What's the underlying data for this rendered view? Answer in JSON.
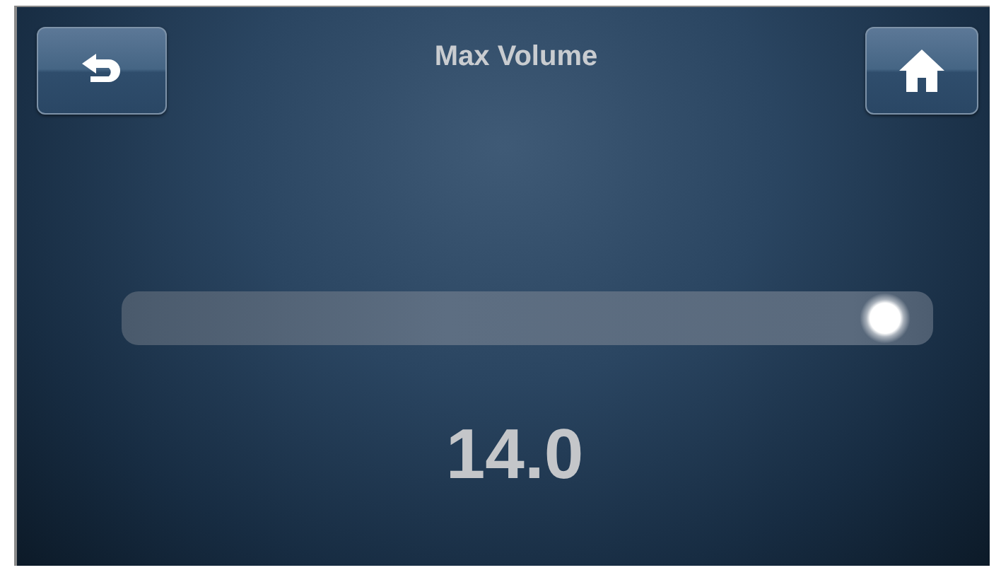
{
  "header": {
    "title": "Max Volume"
  },
  "slider": {
    "level": 0.97
  },
  "reading": "14.0"
}
